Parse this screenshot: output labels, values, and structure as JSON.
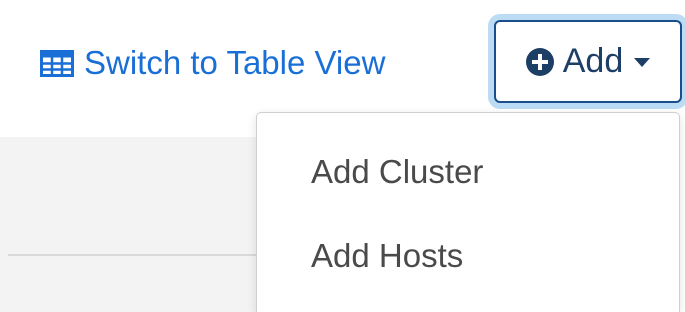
{
  "toolbar": {
    "switch_view_label": "Switch to Table View",
    "switch_view_icon": "table-icon",
    "add_label": "Add",
    "add_icon": "plus-circle-icon",
    "add_caret_icon": "caret-down-icon"
  },
  "add_menu": {
    "items": [
      {
        "label": "Add Cluster"
      },
      {
        "label": "Add Hosts"
      }
    ]
  },
  "colors": {
    "link": "#1a6fd6",
    "button_text": "#1d3f66",
    "button_border": "#1a4e8a",
    "focus_ring": "#bcdcf6",
    "menu_text": "#4a4a4a",
    "panel_bg": "#f3f3f3"
  }
}
